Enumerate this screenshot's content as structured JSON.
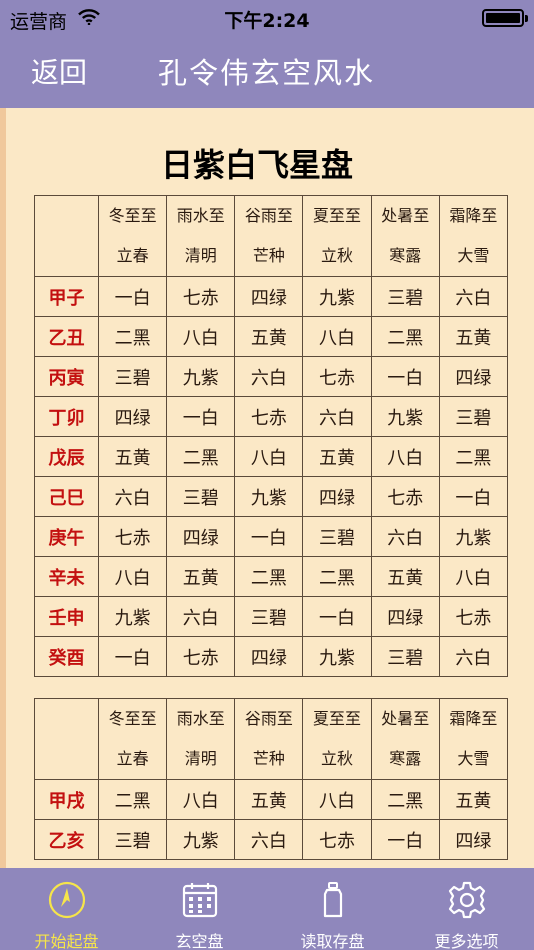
{
  "status": {
    "carrier": "运营商",
    "time": "下午2:24"
  },
  "nav": {
    "back": "返回",
    "title": "孔令伟玄空风水"
  },
  "page": {
    "title": "日紫白飞星盘"
  },
  "table1": {
    "headers": [
      {
        "top": "冬至至",
        "bottom": "立春"
      },
      {
        "top": "雨水至",
        "bottom": "清明"
      },
      {
        "top": "谷雨至",
        "bottom": "芒种"
      },
      {
        "top": "夏至至",
        "bottom": "立秋"
      },
      {
        "top": "处暑至",
        "bottom": "寒露"
      },
      {
        "top": "霜降至",
        "bottom": "大雪"
      }
    ],
    "rows": [
      {
        "day": "甲子",
        "cells": [
          "一白",
          "七赤",
          "四绿",
          "九紫",
          "三碧",
          "六白"
        ]
      },
      {
        "day": "乙丑",
        "cells": [
          "二黑",
          "八白",
          "五黄",
          "八白",
          "二黑",
          "五黄"
        ]
      },
      {
        "day": "丙寅",
        "cells": [
          "三碧",
          "九紫",
          "六白",
          "七赤",
          "一白",
          "四绿"
        ]
      },
      {
        "day": "丁卯",
        "cells": [
          "四绿",
          "一白",
          "七赤",
          "六白",
          "九紫",
          "三碧"
        ]
      },
      {
        "day": "戊辰",
        "cells": [
          "五黄",
          "二黑",
          "八白",
          "五黄",
          "八白",
          "二黑"
        ]
      },
      {
        "day": "己巳",
        "cells": [
          "六白",
          "三碧",
          "九紫",
          "四绿",
          "七赤",
          "一白"
        ]
      },
      {
        "day": "庚午",
        "cells": [
          "七赤",
          "四绿",
          "一白",
          "三碧",
          "六白",
          "九紫"
        ]
      },
      {
        "day": "辛未",
        "cells": [
          "八白",
          "五黄",
          "二黑",
          "二黑",
          "五黄",
          "八白"
        ]
      },
      {
        "day": "壬申",
        "cells": [
          "九紫",
          "六白",
          "三碧",
          "一白",
          "四绿",
          "七赤"
        ]
      },
      {
        "day": "癸酉",
        "cells": [
          "一白",
          "七赤",
          "四绿",
          "九紫",
          "三碧",
          "六白"
        ]
      }
    ]
  },
  "table2": {
    "headers": [
      {
        "top": "冬至至",
        "bottom": "立春"
      },
      {
        "top": "雨水至",
        "bottom": "清明"
      },
      {
        "top": "谷雨至",
        "bottom": "芒种"
      },
      {
        "top": "夏至至",
        "bottom": "立秋"
      },
      {
        "top": "处暑至",
        "bottom": "寒露"
      },
      {
        "top": "霜降至",
        "bottom": "大雪"
      }
    ],
    "rows": [
      {
        "day": "甲戌",
        "cells": [
          "二黑",
          "八白",
          "五黄",
          "八白",
          "二黑",
          "五黄"
        ]
      },
      {
        "day": "乙亥",
        "cells": [
          "三碧",
          "九紫",
          "六白",
          "七赤",
          "一白",
          "四绿"
        ]
      }
    ]
  },
  "tabs": [
    {
      "label": "开始起盘",
      "icon": "compass-icon",
      "active": true
    },
    {
      "label": "玄空盘",
      "icon": "calendar-grid-icon",
      "active": false
    },
    {
      "label": "读取存盘",
      "icon": "bottle-icon",
      "active": false
    },
    {
      "label": "更多选项",
      "icon": "gear-icon",
      "active": false
    }
  ],
  "colors": {
    "bar": "#8f87bc",
    "paper": "#fbe8c6",
    "active_tab": "#f6e54a",
    "day_red": "#c31010"
  }
}
